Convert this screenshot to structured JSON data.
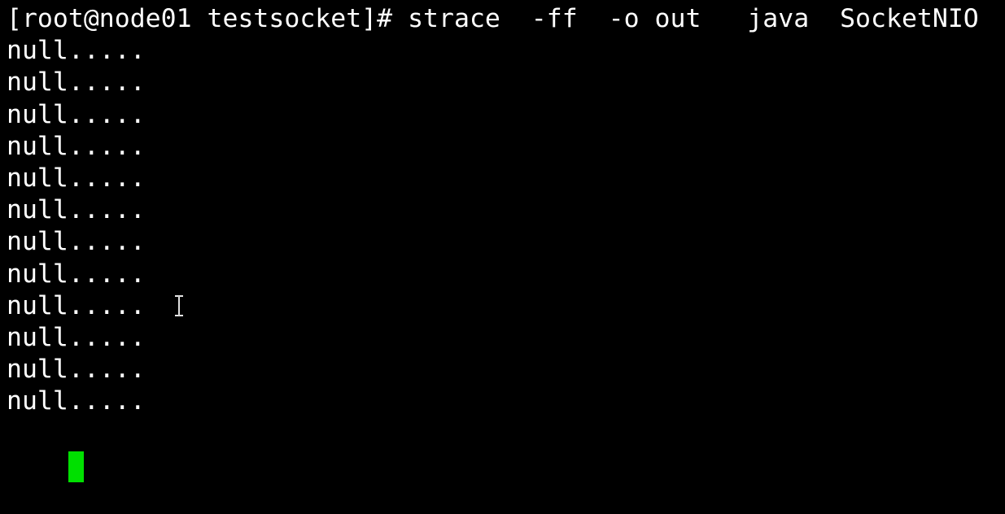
{
  "terminal": {
    "prompt": "[root@node01 testsocket]# strace  -ff  -o out   java  SocketNIO",
    "output_lines": [
      "null.....",
      "null.....",
      "null.....",
      "null.....",
      "null.....",
      "null.....",
      "null.....",
      "null.....",
      "null.....",
      "null.....",
      "null.....",
      "null....."
    ],
    "cursor_color": "#00e000",
    "text_color": "#ffffff",
    "background_color": "#000000",
    "mouse_pointer_icon": "ibeam-pointer-icon"
  }
}
